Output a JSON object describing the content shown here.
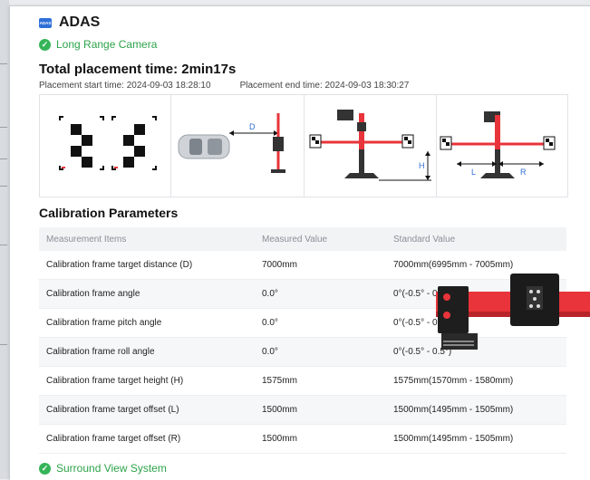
{
  "header": {
    "badge_text": "ADAS",
    "title": "ADAS"
  },
  "camera_status": {
    "label": "Long Range Camera",
    "color": "#2da34a"
  },
  "placement": {
    "total_label": "Total placement time: 2min17s",
    "start_label": "Placement start time: 2024-09-03 18:28:10",
    "end_label": "Placement end time: 2024-09-03 18:30:27"
  },
  "diagram_labels": {
    "d": "D",
    "h": "H",
    "l": "L",
    "r": "R"
  },
  "calibration": {
    "title": "Calibration Parameters",
    "columns": [
      "Measurement Items",
      "Measured Value",
      "Standard Value"
    ],
    "rows": [
      {
        "item": "Calibration frame target distance (D)",
        "measured": "7000mm",
        "standard": "7000mm(6995mm - 7005mm)"
      },
      {
        "item": "Calibration frame angle",
        "measured": "0.0°",
        "standard": "0°(-0.5° - 0.5°)"
      },
      {
        "item": "Calibration frame pitch angle",
        "measured": "0.0°",
        "standard": "0°(-0.5° - 0.5°)"
      },
      {
        "item": "Calibration frame roll angle",
        "measured": "0.0°",
        "standard": "0°(-0.5° - 0.5°)"
      },
      {
        "item": "Calibration frame target height (H)",
        "measured": "1575mm",
        "standard": "1575mm(1570mm - 1580mm)"
      },
      {
        "item": "Calibration frame target offset (L)",
        "measured": "1500mm",
        "standard": "1500mm(1495mm - 1505mm)"
      },
      {
        "item": "Calibration frame target offset (R)",
        "measured": "1500mm",
        "standard": "1500mm(1495mm - 1505mm)"
      }
    ]
  },
  "surround_status": {
    "label": "Surround View System",
    "color": "#2da34a"
  },
  "colors": {
    "accent": "#2f6fd8",
    "success": "#35b458",
    "frame_red": "#e8343a"
  }
}
